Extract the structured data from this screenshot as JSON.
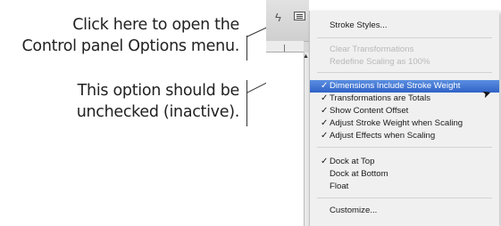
{
  "callouts": {
    "top_line1": "Click here to open the",
    "top_line2": "Control panel Options menu.",
    "bottom_line1": "This option should be",
    "bottom_line2": "unchecked (inactive)."
  },
  "toolbar": {
    "bolt_icon": "lightning-bolt",
    "options_icon": "panel-options-menu"
  },
  "menu": {
    "items": [
      {
        "label": "Stroke Styles...",
        "checked": false,
        "enabled": true
      },
      {
        "label": "Clear Transformations",
        "checked": false,
        "enabled": false
      },
      {
        "label": "Redefine Scaling as 100%",
        "checked": false,
        "enabled": false
      },
      {
        "label": "Dimensions Include Stroke Weight",
        "checked": true,
        "enabled": true,
        "highlighted": true
      },
      {
        "label": "Transformations are Totals",
        "checked": true,
        "enabled": true
      },
      {
        "label": "Show Content Offset",
        "checked": true,
        "enabled": true
      },
      {
        "label": "Adjust Stroke Weight when Scaling",
        "checked": true,
        "enabled": true
      },
      {
        "label": "Adjust Effects when Scaling",
        "checked": true,
        "enabled": true
      },
      {
        "label": "Dock at Top",
        "checked": true,
        "enabled": true
      },
      {
        "label": "Dock at Bottom",
        "checked": false,
        "enabled": true
      },
      {
        "label": "Float",
        "checked": false,
        "enabled": true
      },
      {
        "label": "Customize...",
        "checked": false,
        "enabled": true
      }
    ],
    "check_glyph": "✓"
  },
  "colors": {
    "highlight": "#2f62c8",
    "disabled_text": "#b8b8b8"
  }
}
